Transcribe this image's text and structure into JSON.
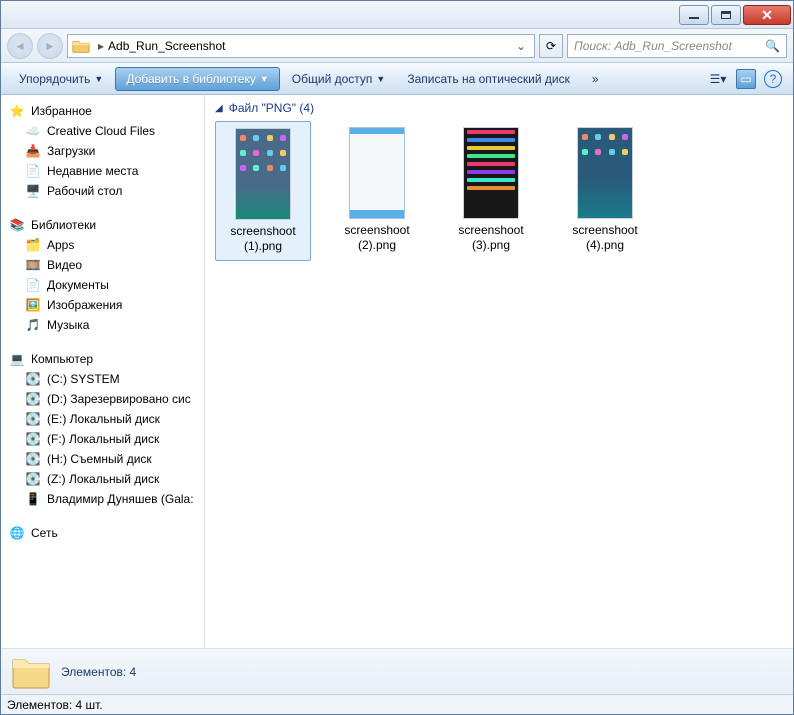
{
  "address": {
    "folder": "Adb_Run_Screenshot"
  },
  "search": {
    "placeholder": "Поиск: Adb_Run_Screenshot"
  },
  "toolbar": {
    "organize": "Упорядочить",
    "add_to_library": "Добавить в библиотеку",
    "share": "Общий доступ",
    "burn": "Записать на оптический диск",
    "more": "»"
  },
  "sidebar": {
    "favorites": {
      "label": "Избранное",
      "items": [
        "Creative Cloud Files",
        "Загрузки",
        "Недавние места",
        "Рабочий стол"
      ]
    },
    "libraries": {
      "label": "Библиотеки",
      "items": [
        "Apps",
        "Видео",
        "Документы",
        "Изображения",
        "Музыка"
      ]
    },
    "computer": {
      "label": "Компьютер",
      "items": [
        "(C:) SYSTEM",
        "(D:) Зарезервировано сис",
        "(E:) Локальный диск",
        "(F:) Локальный диск",
        "(H:) Съемный диск",
        "(Z:) Локальный диск",
        "Владимир Дуняшев (Gala:"
      ]
    },
    "network": {
      "label": "Сеть"
    }
  },
  "content": {
    "group_label": "Файл \"PNG\" (4)",
    "files": [
      {
        "name": "screenshoot (1).png",
        "selected": true,
        "thumb": "t1"
      },
      {
        "name": "screenshoot (2).png",
        "selected": false,
        "thumb": "t2"
      },
      {
        "name": "screenshoot (3).png",
        "selected": false,
        "thumb": "t3"
      },
      {
        "name": "screenshoot (4).png",
        "selected": false,
        "thumb": "t4"
      }
    ]
  },
  "details": {
    "count_label": "Элементов: 4"
  },
  "status": {
    "text": "Элементов: 4 шт."
  }
}
